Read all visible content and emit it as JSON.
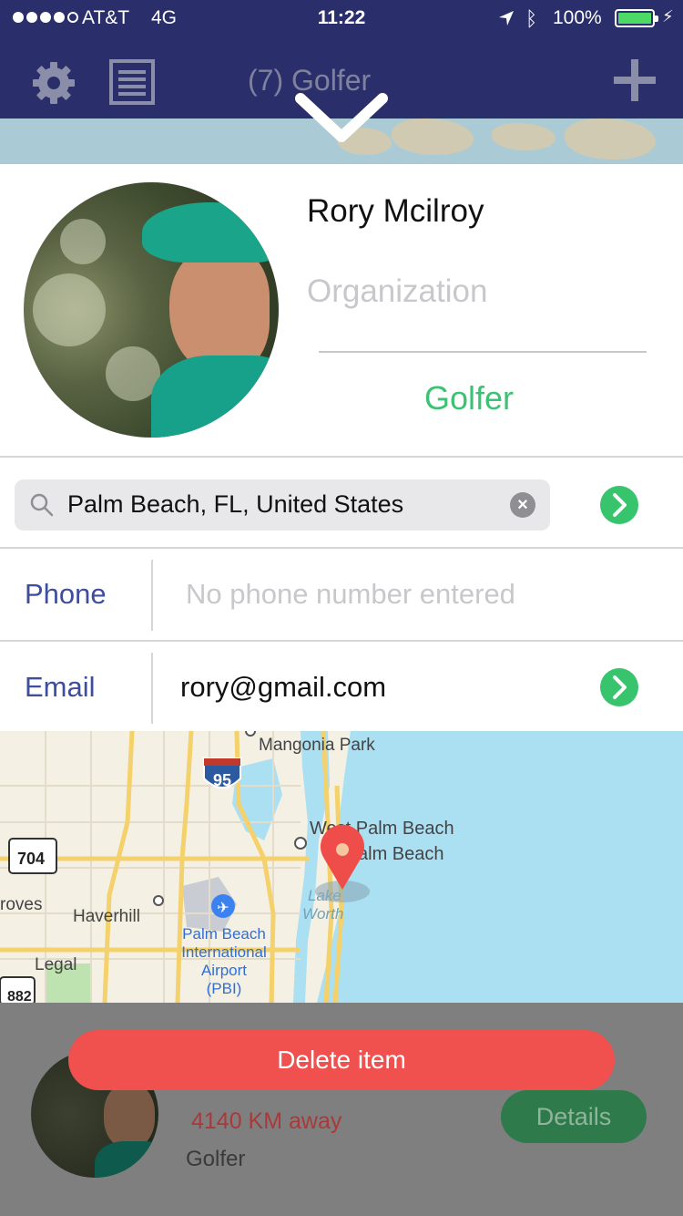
{
  "status_bar": {
    "carrier": "AT&T",
    "network": "4G",
    "time": "11:22",
    "battery": "100%"
  },
  "nav": {
    "title": "(7)  Golfer",
    "icons": [
      "gear-icon",
      "list-icon",
      "plus-icon",
      "chevron-down-icon"
    ]
  },
  "profile": {
    "name": "Rory Mcilroy",
    "organization_placeholder": "Organization",
    "category": "Golfer"
  },
  "search": {
    "value": "Palm Beach, FL, United States"
  },
  "fields": {
    "phone_label": "Phone",
    "phone_placeholder": "No phone number entered",
    "email_label": "Email",
    "email_value": "rory@gmail.com"
  },
  "map": {
    "labels": {
      "mangonia": "Mangonia Park",
      "wpb": "West Palm Beach",
      "pb": "alm Beach",
      "haverhill": "Haverhill",
      "groves": "roves",
      "lake": "Lake",
      "worth": "Worth",
      "airport1": "Palm Beach",
      "airport2": "International",
      "airport3": "Airport",
      "airport4": "(PBI)",
      "legal": "Legal",
      "hw95": "95",
      "hw704": "704",
      "hw882": "882"
    }
  },
  "list_item": {
    "distance": "4140 KM away",
    "category": "Golfer",
    "details_label": "Details"
  },
  "actions": {
    "delete_label": "Delete item"
  },
  "colors": {
    "nav_bg": "#2a2f6b",
    "accent_green": "#3cc274",
    "label_blue": "#3e4d9c",
    "delete_red": "#f0504e"
  }
}
